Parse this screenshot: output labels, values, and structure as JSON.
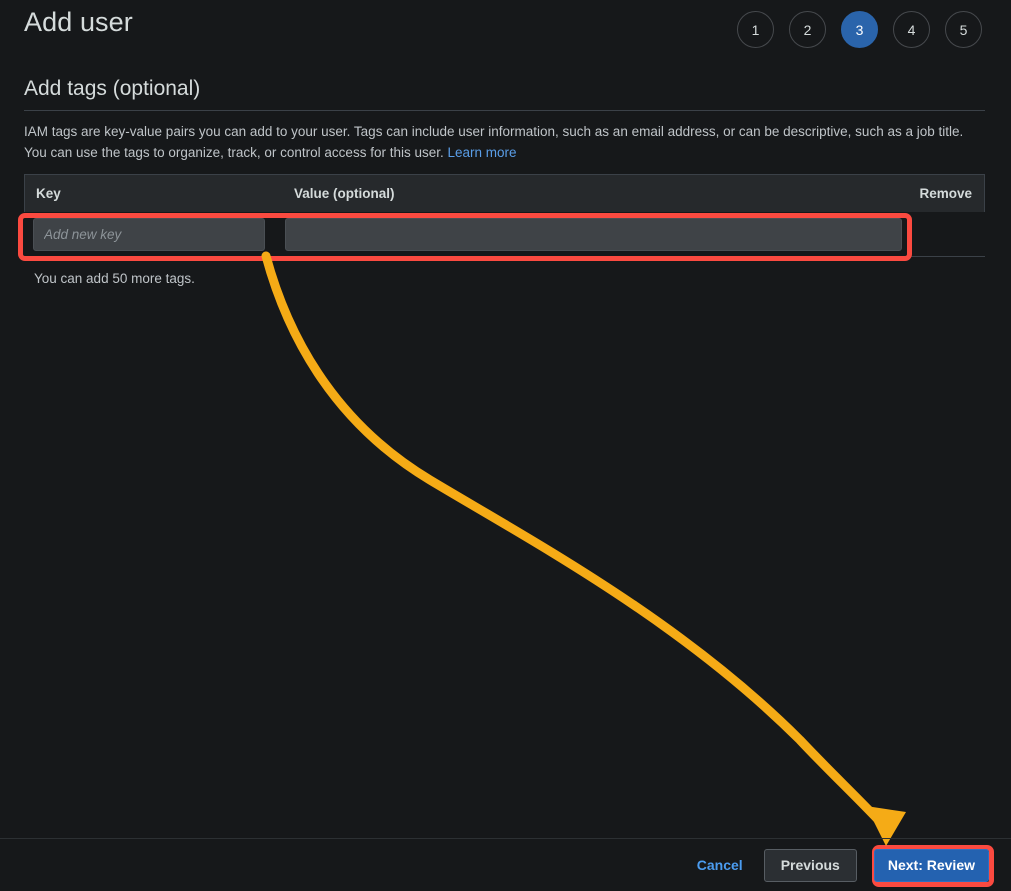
{
  "header": {
    "title": "Add user",
    "steps": [
      {
        "label": "1",
        "active": false
      },
      {
        "label": "2",
        "active": false
      },
      {
        "label": "3",
        "active": true
      },
      {
        "label": "4",
        "active": false
      },
      {
        "label": "5",
        "active": false
      }
    ]
  },
  "section": {
    "title": "Add tags (optional)",
    "description_part1": "IAM tags are key-value pairs you can add to your user. Tags can include user information, such as an email address, or can be descriptive, such as a job title. You can use the tags to organize, track, or control access for this user. ",
    "learn_more_label": "Learn more"
  },
  "tag_table": {
    "columns": {
      "key": "Key",
      "value": "Value (optional)",
      "remove": "Remove"
    },
    "rows": [
      {
        "key_value": "",
        "key_placeholder": "Add new key",
        "value_value": "",
        "value_placeholder": ""
      }
    ],
    "note": "You can add 50 more tags."
  },
  "footer": {
    "cancel_label": "Cancel",
    "previous_label": "Previous",
    "next_label": "Next: Review"
  },
  "annotations": {
    "highlight_color": "#fb4a40",
    "arrow_color": "#f5ab16",
    "arrow_description": "curved-arrow-from-key-field-to-next-review-button"
  },
  "colors": {
    "background": "#16181a",
    "accent_blue": "#2a64ab",
    "link_blue": "#5a9ee8",
    "text": "#d5dbdb"
  }
}
